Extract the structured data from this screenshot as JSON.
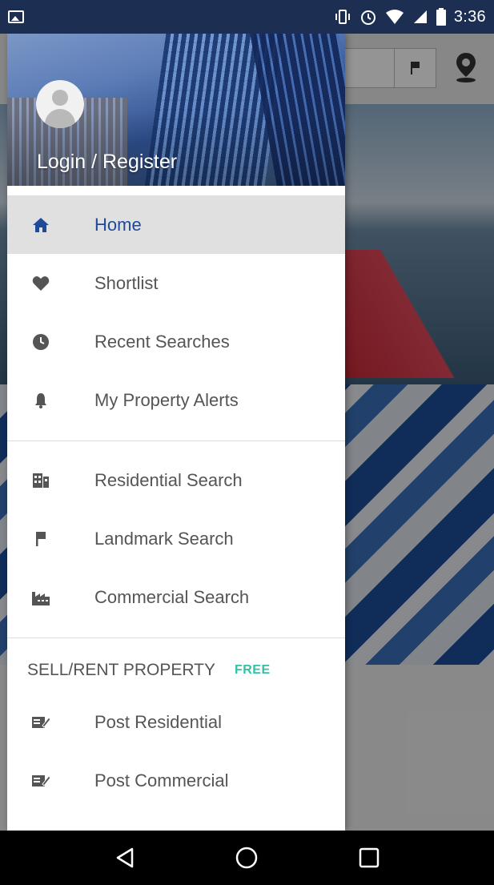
{
  "status_bar": {
    "time": "3:36"
  },
  "drawer": {
    "header": {
      "login_label": "Login / Register"
    },
    "menu_group_1": [
      {
        "label": "Home",
        "icon": "home-icon",
        "active": true
      },
      {
        "label": "Shortlist",
        "icon": "heart-icon",
        "active": false
      },
      {
        "label": "Recent Searches",
        "icon": "clock-icon",
        "active": false
      },
      {
        "label": "My Property Alerts",
        "icon": "bell-icon",
        "active": false
      }
    ],
    "menu_group_2": [
      {
        "label": "Residential Search",
        "icon": "building-icon"
      },
      {
        "label": "Landmark Search",
        "icon": "flag-icon"
      },
      {
        "label": "Commercial Search",
        "icon": "factory-icon"
      }
    ],
    "section": {
      "title": "SELL/RENT PROPERTY",
      "badge": "FREE"
    },
    "menu_group_3": [
      {
        "label": "Post Residential",
        "icon": "edit-form-icon"
      },
      {
        "label": "Post Commercial",
        "icon": "edit-form-icon"
      }
    ]
  },
  "colors": {
    "accent": "#1f4a9a",
    "status_bar": "#1c2f52",
    "free_badge": "#34c1a2",
    "active_row": "#e0e0e0"
  },
  "nav_bar": {
    "buttons": [
      "back-icon",
      "home-circle-icon",
      "recents-square-icon"
    ]
  }
}
